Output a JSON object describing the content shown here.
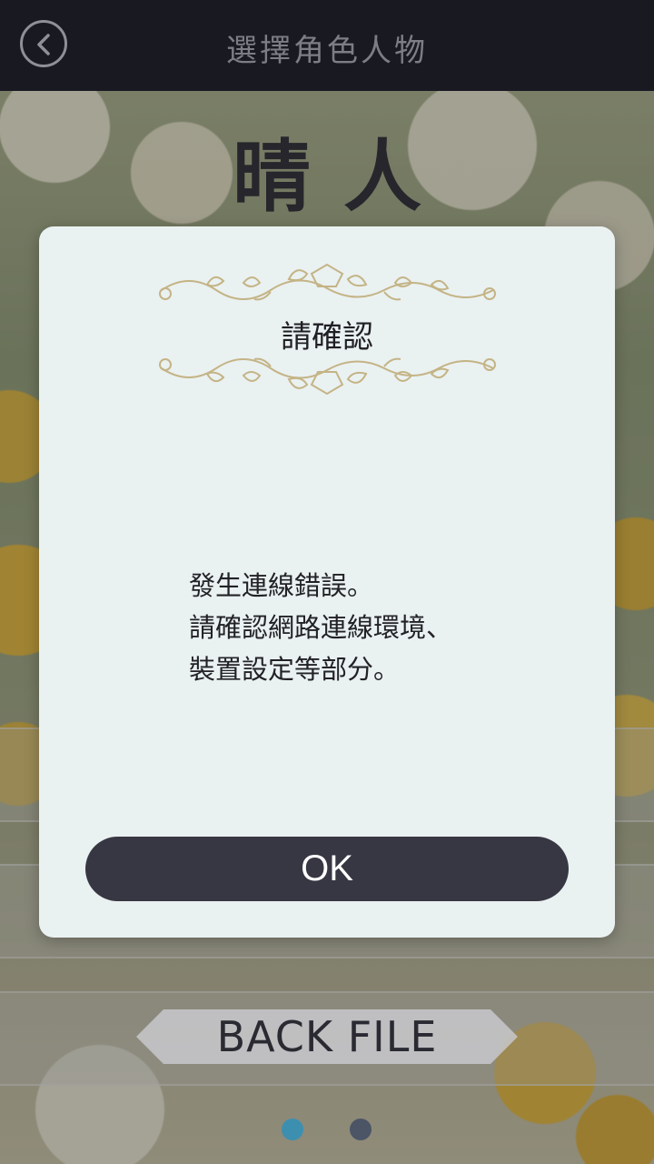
{
  "topbar": {
    "title": "選擇角色人物",
    "back_icon": "chevron-left-icon"
  },
  "character": {
    "name": "晴人"
  },
  "background": {
    "back_file_label": "BACK FILE",
    "page_dots": [
      {
        "active": true,
        "color": "#3d8fb0"
      },
      {
        "active": false,
        "color": "#4b5566"
      }
    ]
  },
  "dialog": {
    "title": "請確認",
    "message_lines": [
      "發生連線錯誤。",
      "請確認網路連線環境、",
      "裝置設定等部分。"
    ],
    "ok_label": "OK",
    "ornament_icon": "vine-ornament-icon"
  },
  "colors": {
    "accent_dark": "#373743",
    "dialog_bg": "#eaf1f1",
    "ornament_gold": "#c4b486"
  }
}
